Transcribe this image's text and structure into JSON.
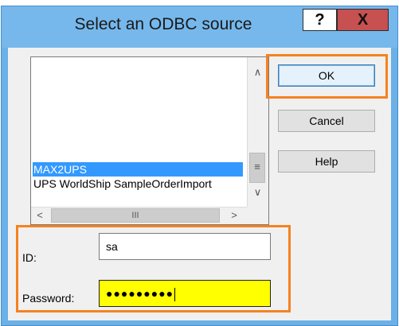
{
  "dialog": {
    "title": "Select an ODBC source",
    "help_caption": "?",
    "close_caption": "X"
  },
  "list": {
    "items": [
      {
        "label": "MAX2UPS",
        "selected": true
      },
      {
        "label": "UPS WorldShip SampleOrderImport",
        "selected": false
      }
    ]
  },
  "scrollbars": {
    "up": "∧",
    "down": "∨",
    "left": "<",
    "right": ">",
    "v_thumb": "≡",
    "h_thumb": "III"
  },
  "buttons": {
    "ok": "OK",
    "cancel": "Cancel",
    "help": "Help"
  },
  "credentials": {
    "id_label": "ID:",
    "id_value": "sa",
    "password_label": "Password:",
    "password_value": "●●●●●●●●●"
  },
  "colors": {
    "highlight": "#f58220",
    "selection": "#3399ff",
    "password_bg": "#ffff00",
    "title_bar": "#76b8ec"
  }
}
